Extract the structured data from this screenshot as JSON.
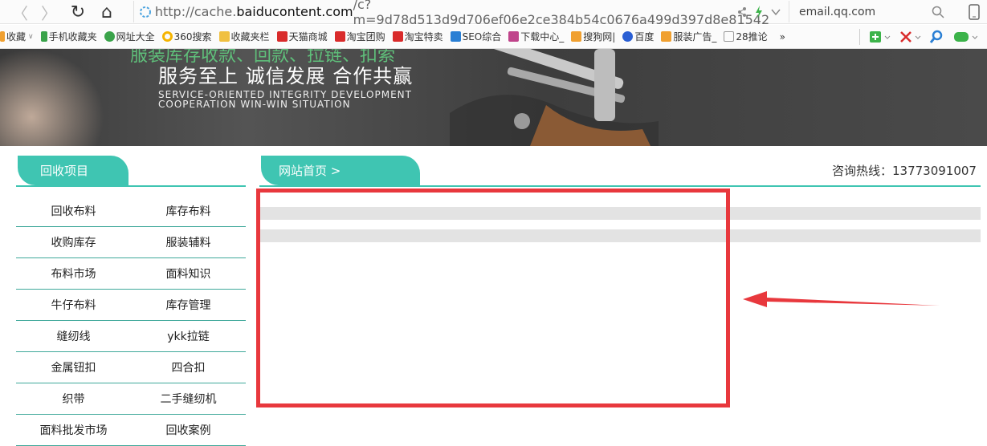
{
  "browser": {
    "back_glyph": "〈",
    "forward_glyph": "〉",
    "reload_glyph": "↻",
    "home_glyph": "⌂",
    "url_prefix": "http://cache.",
    "url_domain": "baiducontent.com",
    "url_rest": "/c?m=9d78d513d9d706ef06e2ce384b54c0676a499d397d8e81542",
    "search_text": "email.qq.com"
  },
  "bookmarks": [
    {
      "label": "收藏",
      "color": "#f0a030"
    },
    {
      "label": "手机收藏夹",
      "color": "#3aa34a"
    },
    {
      "label": "网址大全",
      "color": "#3aa34a"
    },
    {
      "label": "360搜索",
      "color": "#f5b400"
    },
    {
      "label": "收藏夹栏",
      "color": "#f0c040"
    },
    {
      "label": "天猫商城",
      "color": "#d92b2b"
    },
    {
      "label": "淘宝团购",
      "color": "#d92b2b"
    },
    {
      "label": "淘宝特卖",
      "color": "#d92b2b"
    },
    {
      "label": "SEO综合",
      "color": "#2a7fd4"
    },
    {
      "label": "下载中心_",
      "color": "#c0448b"
    },
    {
      "label": "搜狗网|",
      "color": "#f0a030"
    },
    {
      "label": "百度",
      "color": "#2a5fd4"
    },
    {
      "label": "服装广告_",
      "color": "#f0a030"
    },
    {
      "label": "28推论",
      "color": "#cccccc"
    }
  ],
  "bookmarks_more": "»",
  "banner": {
    "green_text": "服装库存收款、回款、拉链、扣索",
    "slogan": "服务至上  诚信发展  合作共赢",
    "en_line1": "SERVICE-ORIENTED INTEGRITY DEVELOPMENT",
    "en_line2": "COOPERATION WIN-WIN SITUATION"
  },
  "sidebar": {
    "title": "回收项目",
    "rows": [
      [
        "回收布料",
        "库存布料"
      ],
      [
        "收购库存",
        "服装辅料"
      ],
      [
        "布料市场",
        "面料知识"
      ],
      [
        "牛仔布料",
        "库存管理"
      ],
      [
        "缝纫线",
        "ykk拉链"
      ],
      [
        "金属钮扣",
        "四合扣"
      ],
      [
        "织带",
        "二手缝纫机"
      ],
      [
        "面料批发市场",
        "回收案例"
      ]
    ]
  },
  "main": {
    "breadcrumb": "网站首页 >",
    "hotline": "咨询热线：13773091007"
  },
  "colors": {
    "accent": "#3fc5b2",
    "annotation_red": "#e8383d"
  }
}
